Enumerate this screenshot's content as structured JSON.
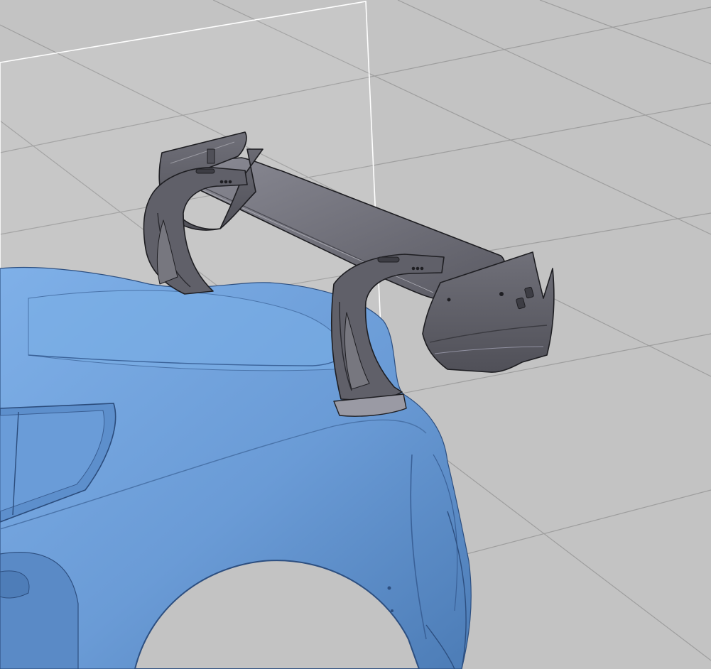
{
  "viewport": {
    "background": "#c3c3c3",
    "grid_color": "#9e9e9e",
    "plane_edge_color": "#ffffff"
  },
  "model": {
    "body_color": "#6f9fd8",
    "body_shadow": "#4f7fb8",
    "body_highlight": "#8ebbef",
    "wing_color": "#6c6c76",
    "wing_dark": "#3d3d44",
    "wing_light": "#8a8a94",
    "edge_color": "#1e1e22"
  }
}
